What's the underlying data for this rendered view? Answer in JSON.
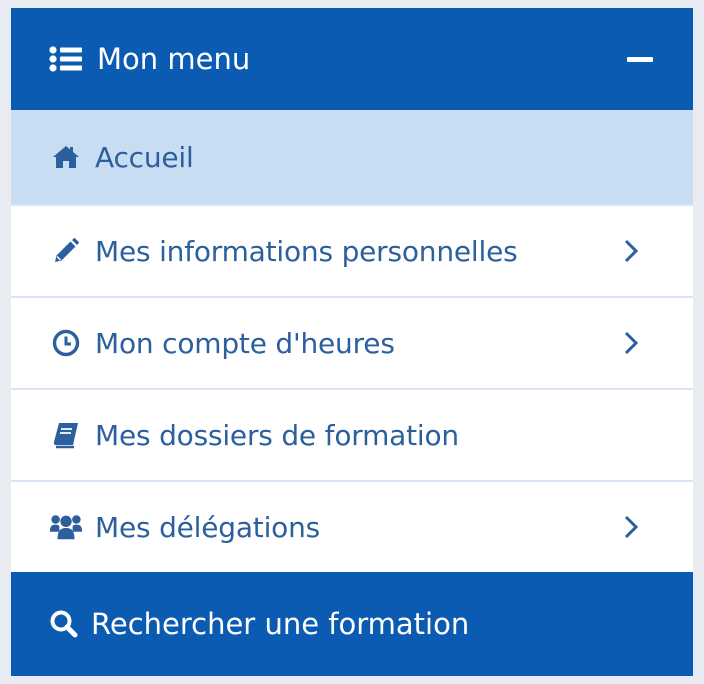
{
  "menu": {
    "title": "Mon menu",
    "title_icon": "list-icon",
    "collapse_icon": "minus-icon"
  },
  "items": [
    {
      "label": "Accueil",
      "icon": "home-icon",
      "active": true,
      "has_chevron": false
    },
    {
      "label": "Mes informations personnelles",
      "icon": "pencil-icon",
      "active": false,
      "has_chevron": true
    },
    {
      "label": "Mon compte d'heures",
      "icon": "clock-icon",
      "active": false,
      "has_chevron": true
    },
    {
      "label": "Mes dossiers de formation",
      "icon": "book-icon",
      "active": false,
      "has_chevron": false
    },
    {
      "label": "Mes délégations",
      "icon": "users-icon",
      "active": false,
      "has_chevron": true
    }
  ],
  "search": {
    "label": "Rechercher une formation",
    "icon": "search-icon"
  },
  "colors": {
    "brand": "#0b5bb3",
    "active_bg": "#c8dcf2",
    "text": "#2c5f9e"
  }
}
